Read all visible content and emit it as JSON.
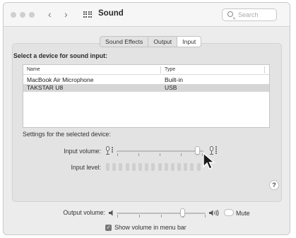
{
  "window": {
    "title": "Sound",
    "nav_back": "‹",
    "nav_forward": "›",
    "search_placeholder": "Search"
  },
  "tabs": [
    {
      "label": "Sound Effects",
      "active": false
    },
    {
      "label": "Output",
      "active": false
    },
    {
      "label": "Input",
      "active": true
    }
  ],
  "input": {
    "heading": "Select a device for sound input:",
    "columns": [
      "Name",
      "Type"
    ],
    "devices": [
      {
        "name": "MacBook Air Microphone",
        "type": "Built-in",
        "selected": false
      },
      {
        "name": "TAKSTAR U8",
        "type": "USB",
        "selected": true
      }
    ],
    "settings_label": "Settings for the selected device:",
    "volume_label": "Input volume:",
    "volume_fraction": 0.93,
    "level_label": "Input level:",
    "level_bars": 15,
    "level_lit": 0,
    "help": "?"
  },
  "output": {
    "volume_label": "Output volume:",
    "volume_fraction": 0.74,
    "mute_label": "Mute",
    "mute_on": false,
    "menu_bar_label": "Show volume in menu bar",
    "menu_bar_checked": true,
    "check_glyph": "✓"
  },
  "icons": {
    "window_close": "traffic-light-close",
    "window_minimize": "traffic-light-minimize",
    "window_zoom": "traffic-light-zoom",
    "show_all": "grid-icon",
    "search": "search-icon",
    "mic_low": "microphone-low-icon",
    "mic_high": "microphone-high-icon",
    "speaker_low": "speaker-low-icon",
    "speaker_high": "speaker-high-icon",
    "pointer": "mouse-pointer-icon"
  },
  "colors": {
    "window_bg": "#ececec",
    "panel_bg": "#e3e3e3",
    "selected_row": "#d6d6d6",
    "checkbox": "#777777"
  }
}
